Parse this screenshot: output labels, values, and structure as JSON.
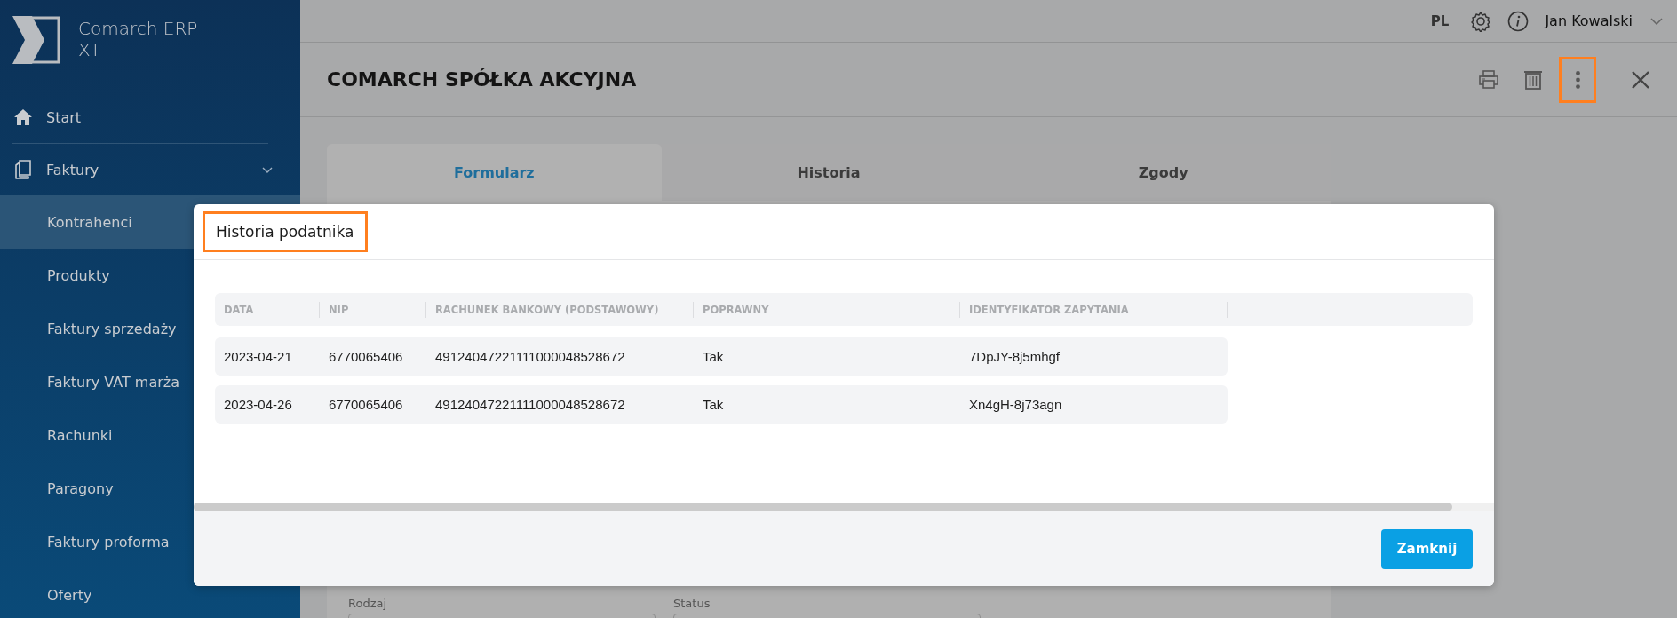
{
  "app": {
    "logo_text": "Comarch ERP XT"
  },
  "sidebar": {
    "items": [
      {
        "kind": "link",
        "label": "Start",
        "selected": false
      },
      {
        "kind": "group",
        "label": "Faktury",
        "selected": false,
        "expanded": true,
        "children": [
          {
            "label": "Kontrahenci",
            "selected": true
          },
          {
            "label": "Produkty",
            "selected": false
          },
          {
            "label": "Faktury sprzedaży",
            "selected": false
          },
          {
            "label": "Faktury VAT marża",
            "selected": false
          },
          {
            "label": "Rachunki",
            "selected": false
          },
          {
            "label": "Paragony",
            "selected": false
          },
          {
            "label": "Faktury proforma",
            "selected": false
          },
          {
            "label": "Oferty",
            "selected": false
          }
        ]
      }
    ]
  },
  "top_bar": {
    "language": "PL",
    "user": "Jan Kowalski"
  },
  "header": {
    "title": "COMARCH SPÓŁKA AKCYJNA",
    "actions": [
      {
        "kind": "print",
        "highlighted": false
      },
      {
        "kind": "delete",
        "highlighted": false
      },
      {
        "kind": "more",
        "highlighted": true
      },
      {
        "kind": "close",
        "highlighted": false
      }
    ]
  },
  "tabs": [
    {
      "label": "Formularz",
      "selected": true
    },
    {
      "label": "Historia",
      "selected": false
    },
    {
      "label": "Zgody",
      "selected": false
    }
  ],
  "form_fields": [
    {
      "label": "Rodzaj"
    },
    {
      "label": "Status"
    }
  ],
  "dialog": {
    "title": "Historia podatnika",
    "title_highlighted": true,
    "columns": [
      "DATA",
      "NIP",
      "RACHUNEK BANKOWY (PODSTAWOWY)",
      "POPRAWNY",
      "IDENTYFIKATOR ZAPYTANIA"
    ],
    "rows": [
      {
        "cells": [
          "2023-04-21",
          "6770065406",
          "49124047221111000048528672",
          "Tak",
          "7DpJY-8j5mhgf"
        ]
      },
      {
        "cells": [
          "2023-04-26",
          "6770065406",
          "49124047221111000048528672",
          "Tak",
          "Xn4gH-8j73agn"
        ]
      }
    ],
    "close_button": "Zamknij"
  }
}
